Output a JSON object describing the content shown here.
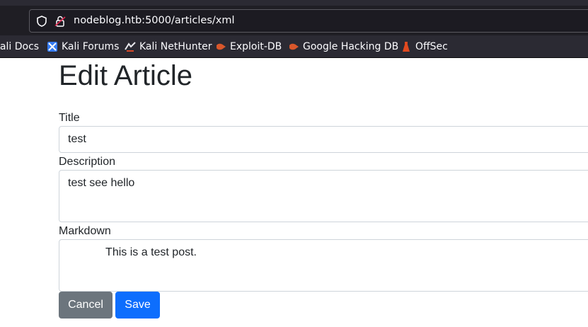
{
  "browser": {
    "url": "nodeblog.htb:5000/articles/xml",
    "bookmarks": [
      {
        "label": "Kali Docs",
        "icon": "kali-docs-icon"
      },
      {
        "label": "Kali Forums",
        "icon": "kali-forums-icon"
      },
      {
        "label": "Kali NetHunter",
        "icon": "kali-nethunter-icon"
      },
      {
        "label": "Exploit-DB",
        "icon": "exploit-db-icon"
      },
      {
        "label": "Google Hacking DB",
        "icon": "exploit-db-icon"
      },
      {
        "label": "OffSec",
        "icon": "offsec-icon"
      }
    ]
  },
  "page": {
    "title": "Edit Article"
  },
  "form": {
    "title_label": "Title",
    "title_value": "test",
    "description_label": "Description",
    "description_value": "test see hello",
    "markdown_label": "Markdown",
    "markdown_value": "            This is a test post.",
    "cancel_label": "Cancel",
    "save_label": "Save"
  },
  "colors": {
    "cancel_button": "#6c757d",
    "save_button": "#0d6efd",
    "text": "#212529"
  }
}
